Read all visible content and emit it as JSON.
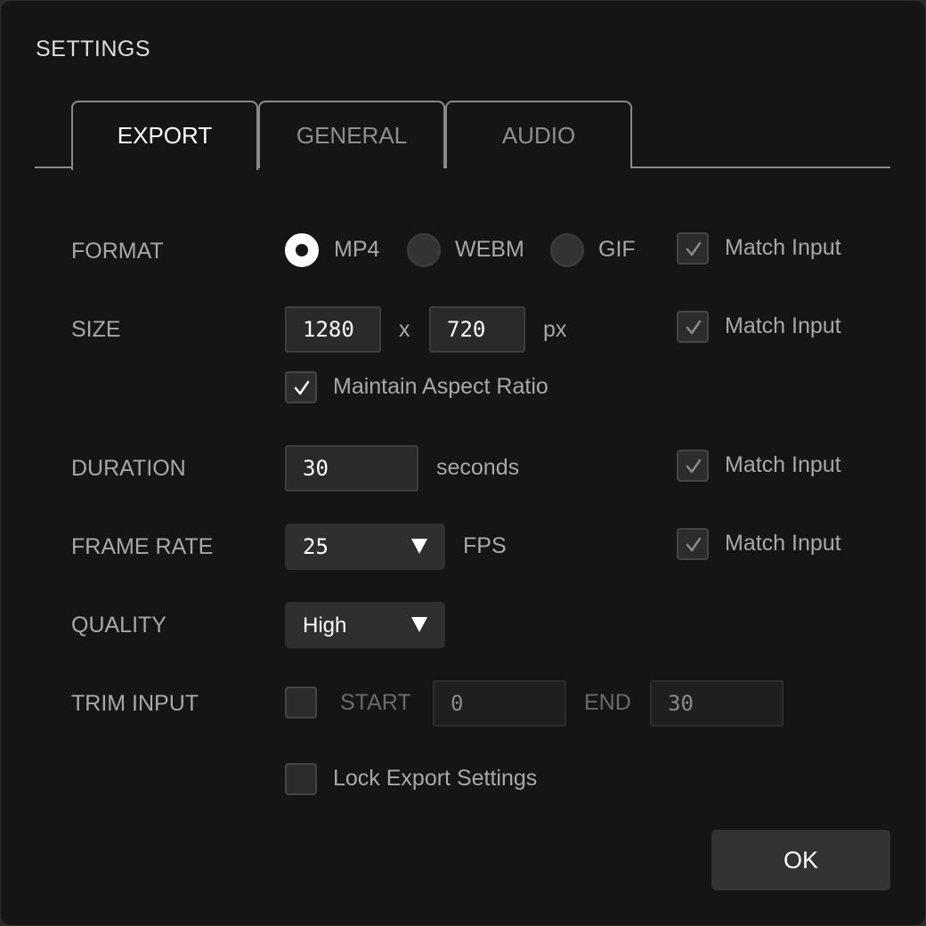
{
  "dialog": {
    "title": "SETTINGS"
  },
  "tabs": [
    {
      "label": "EXPORT",
      "active": true
    },
    {
      "label": "GENERAL",
      "active": false
    },
    {
      "label": "AUDIO",
      "active": false
    }
  ],
  "format": {
    "label": "FORMAT",
    "options": [
      {
        "label": "MP4",
        "selected": true
      },
      {
        "label": "WEBM",
        "selected": false
      },
      {
        "label": "GIF",
        "selected": false
      }
    ],
    "match_input": {
      "label": "Match Input",
      "checked": true
    }
  },
  "size": {
    "label": "SIZE",
    "width": "1280",
    "separator": "x",
    "height": "720",
    "unit": "px",
    "match_input": {
      "label": "Match Input",
      "checked": true
    },
    "maintain_aspect": {
      "label": "Maintain Aspect Ratio",
      "checked": true
    }
  },
  "duration": {
    "label": "DURATION",
    "value": "30",
    "unit": "seconds",
    "match_input": {
      "label": "Match Input",
      "checked": true
    }
  },
  "frame_rate": {
    "label": "FRAME RATE",
    "value": "25",
    "unit": "FPS",
    "match_input": {
      "label": "Match Input",
      "checked": true
    }
  },
  "quality": {
    "label": "QUALITY",
    "value": "High"
  },
  "trim": {
    "label": "TRIM INPUT",
    "checked": false,
    "start_label": "START",
    "start_value": "0",
    "end_label": "END",
    "end_value": "30"
  },
  "lock": {
    "label": "Lock Export Settings",
    "checked": false
  },
  "ok_label": "OK",
  "colors": {
    "background": "#151515",
    "active_text": "#ffffff",
    "muted_text": "#a8a8a8"
  }
}
